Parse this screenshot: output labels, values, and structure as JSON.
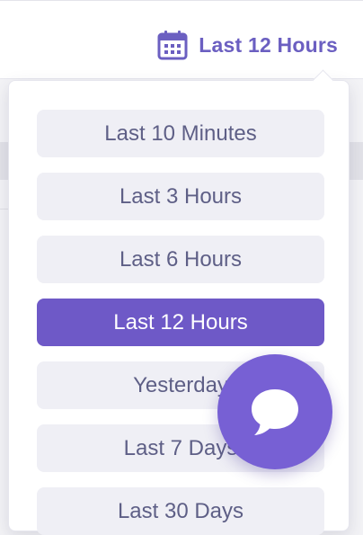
{
  "header": {
    "range_label": "Last 12 Hours",
    "icon": "calendar-icon"
  },
  "dropdown": {
    "options": [
      {
        "label": "Last 10 Minutes"
      },
      {
        "label": "Last 3 Hours"
      },
      {
        "label": "Last 6 Hours"
      },
      {
        "label": "Last 12 Hours",
        "selected": true
      },
      {
        "label": "Yesterday"
      },
      {
        "label": "Last 7 Days"
      },
      {
        "label": "Last 30 Days"
      }
    ]
  },
  "chat": {
    "icon": "chat-bubble-icon"
  },
  "colors": {
    "accent": "#6e59c7",
    "chat_button": "#7760d4",
    "option_bg": "#efeff5",
    "option_text": "#5e5f86"
  }
}
